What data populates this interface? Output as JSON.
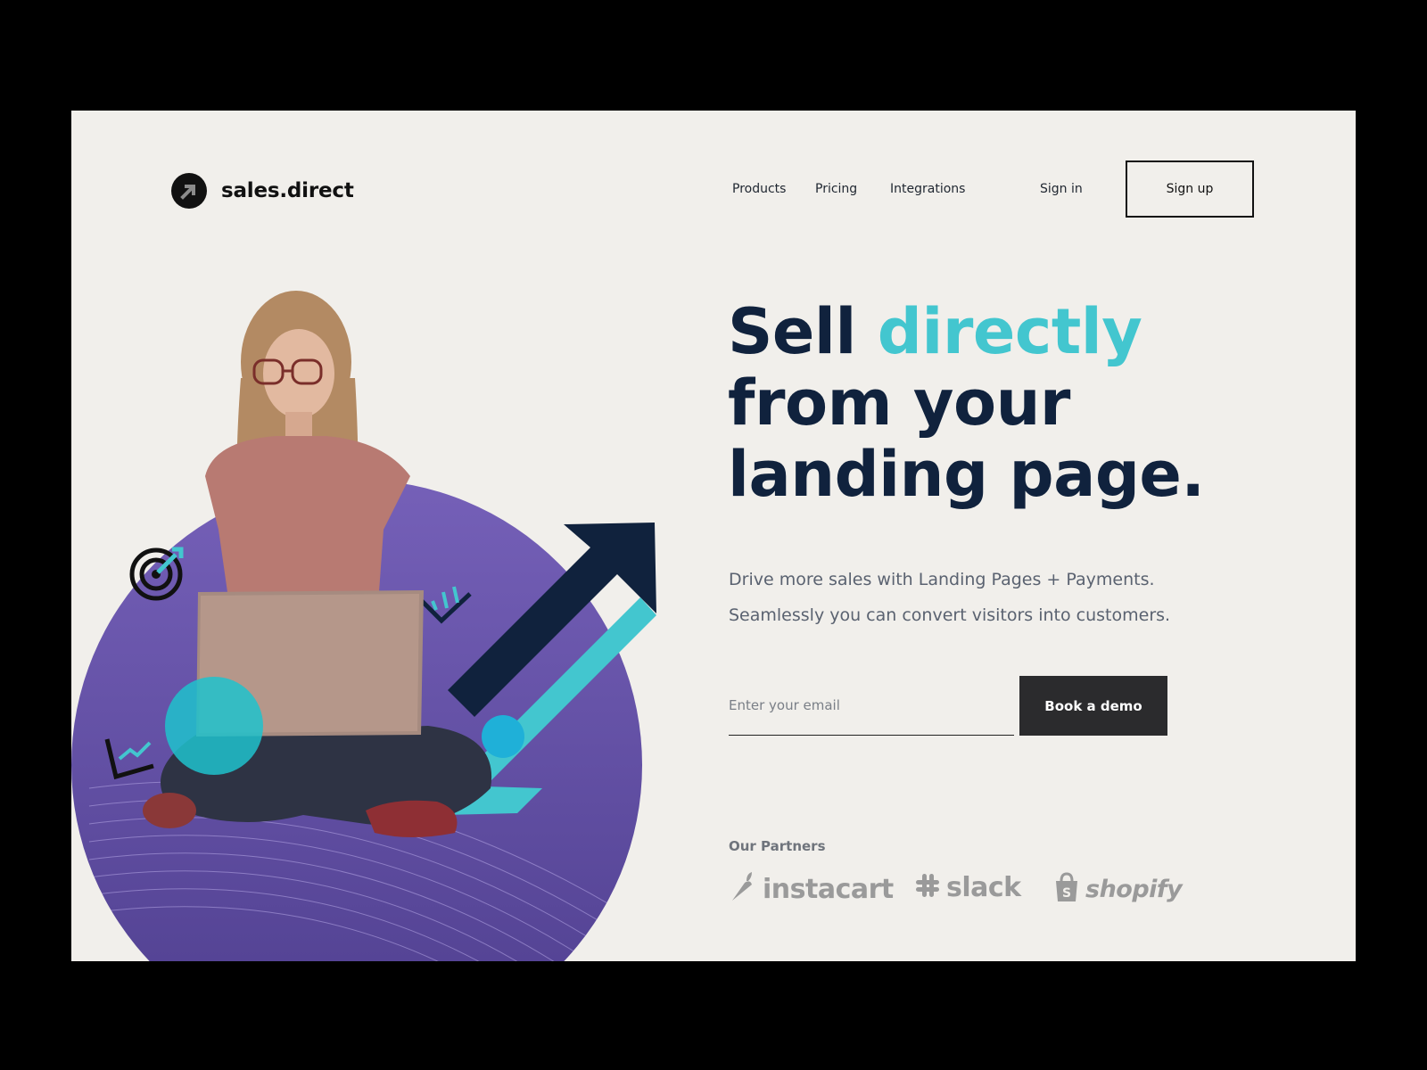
{
  "brand": {
    "name": "sales.direct",
    "logo_icon": "arrow-icon"
  },
  "nav": {
    "products": "Products",
    "pricing": "Pricing",
    "integrations": "Integrations",
    "signin": "Sign in",
    "signup": "Sign up"
  },
  "hero": {
    "headline_part1": "Sell ",
    "headline_accent": "directly",
    "headline_line2": "from your",
    "headline_line3": "landing page.",
    "subtitle_line1": "Drive more sales with Landing Pages + Payments.",
    "subtitle_line2": "Seamlessly you can convert visitors into customers."
  },
  "form": {
    "email_placeholder": "Enter your email",
    "cta_label": "Book a demo"
  },
  "partners": {
    "label": "Our Partners",
    "items": [
      {
        "name": "instacart",
        "icon": "carrot-icon"
      },
      {
        "name": "slack",
        "icon": "slack-hash-icon"
      },
      {
        "name": "shopify",
        "icon": "shopping-bag-icon"
      }
    ]
  },
  "colors": {
    "background": "#f1efeb",
    "navy": "#10223d",
    "accent": "#43c6cf",
    "purple": "#5e4aa3",
    "button": "#2b2b2d"
  }
}
